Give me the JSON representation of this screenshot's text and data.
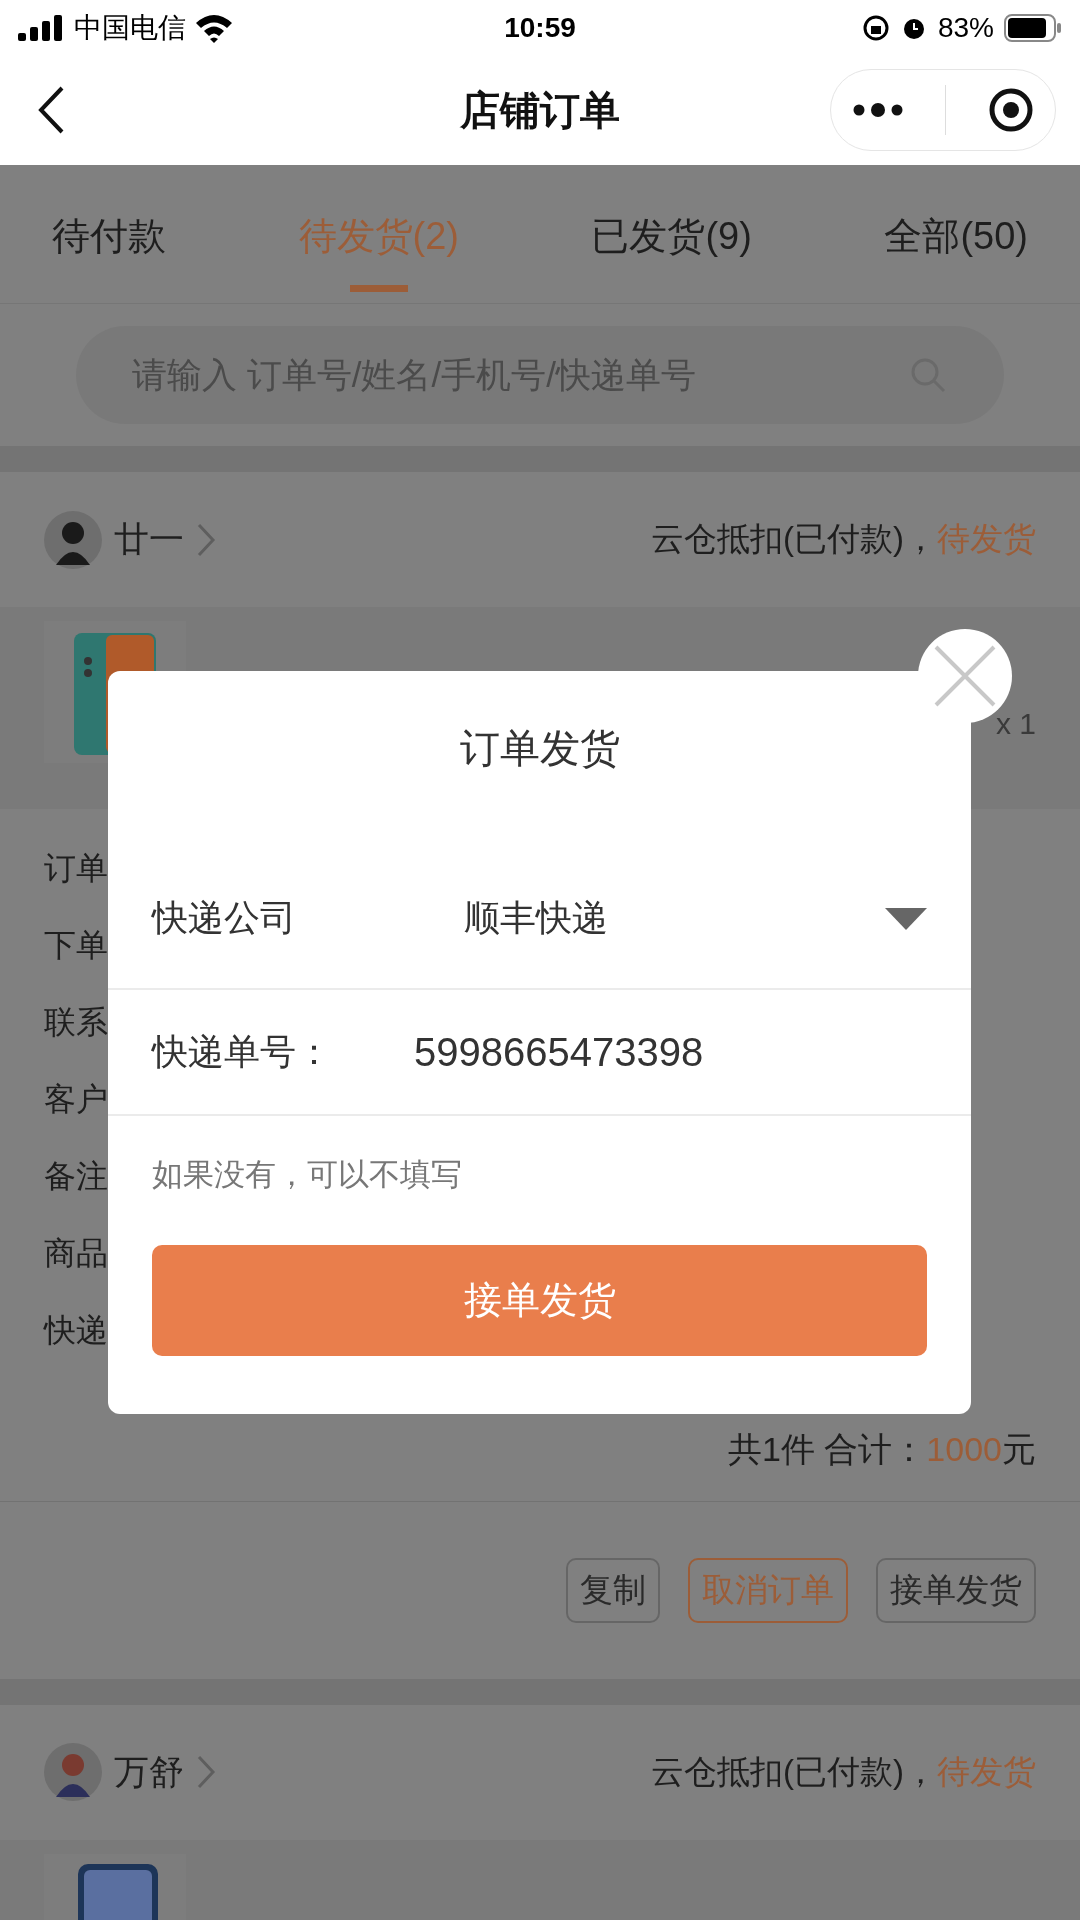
{
  "status_bar": {
    "carrier": "中国电信",
    "time": "10:59",
    "battery": "83%"
  },
  "nav": {
    "title": "店铺订单"
  },
  "tabs": [
    {
      "label": "待付款",
      "selected": false
    },
    {
      "label": "待发货(2)",
      "selected": true
    },
    {
      "label": "已发货(9)",
      "selected": false
    },
    {
      "label": "全部(50)",
      "selected": false
    }
  ],
  "search": {
    "placeholder": "请输入 订单号/姓名/手机号/快递单号"
  },
  "orders": [
    {
      "buyer": "廿一",
      "payment": "云仓抵扣(已付款)，",
      "status": "待发货",
      "product": {
        "qty": "x 1"
      },
      "details": [
        "订单",
        "下单",
        "联系",
        "客户",
        "备注",
        "商品",
        "快递"
      ],
      "total": {
        "count": "共1件 合计：",
        "amount": "1000",
        "unit": "元"
      },
      "actions": [
        {
          "label": "复制",
          "highlighted": false
        },
        {
          "label": "取消订单",
          "highlighted": true
        },
        {
          "label": "接单发货",
          "highlighted": false
        }
      ]
    },
    {
      "buyer": "万舒",
      "payment": "云仓抵扣(已付款)，",
      "status": "待发货"
    }
  ],
  "dialog": {
    "title": "订单发货",
    "fields": [
      {
        "kind": "select",
        "label": "快递公司",
        "value": "顺丰快递"
      },
      {
        "kind": "input",
        "label": "快递单号：",
        "value": "5998665473398"
      }
    ],
    "hint": "如果没有，可以不填写",
    "submit": "接单发货"
  }
}
